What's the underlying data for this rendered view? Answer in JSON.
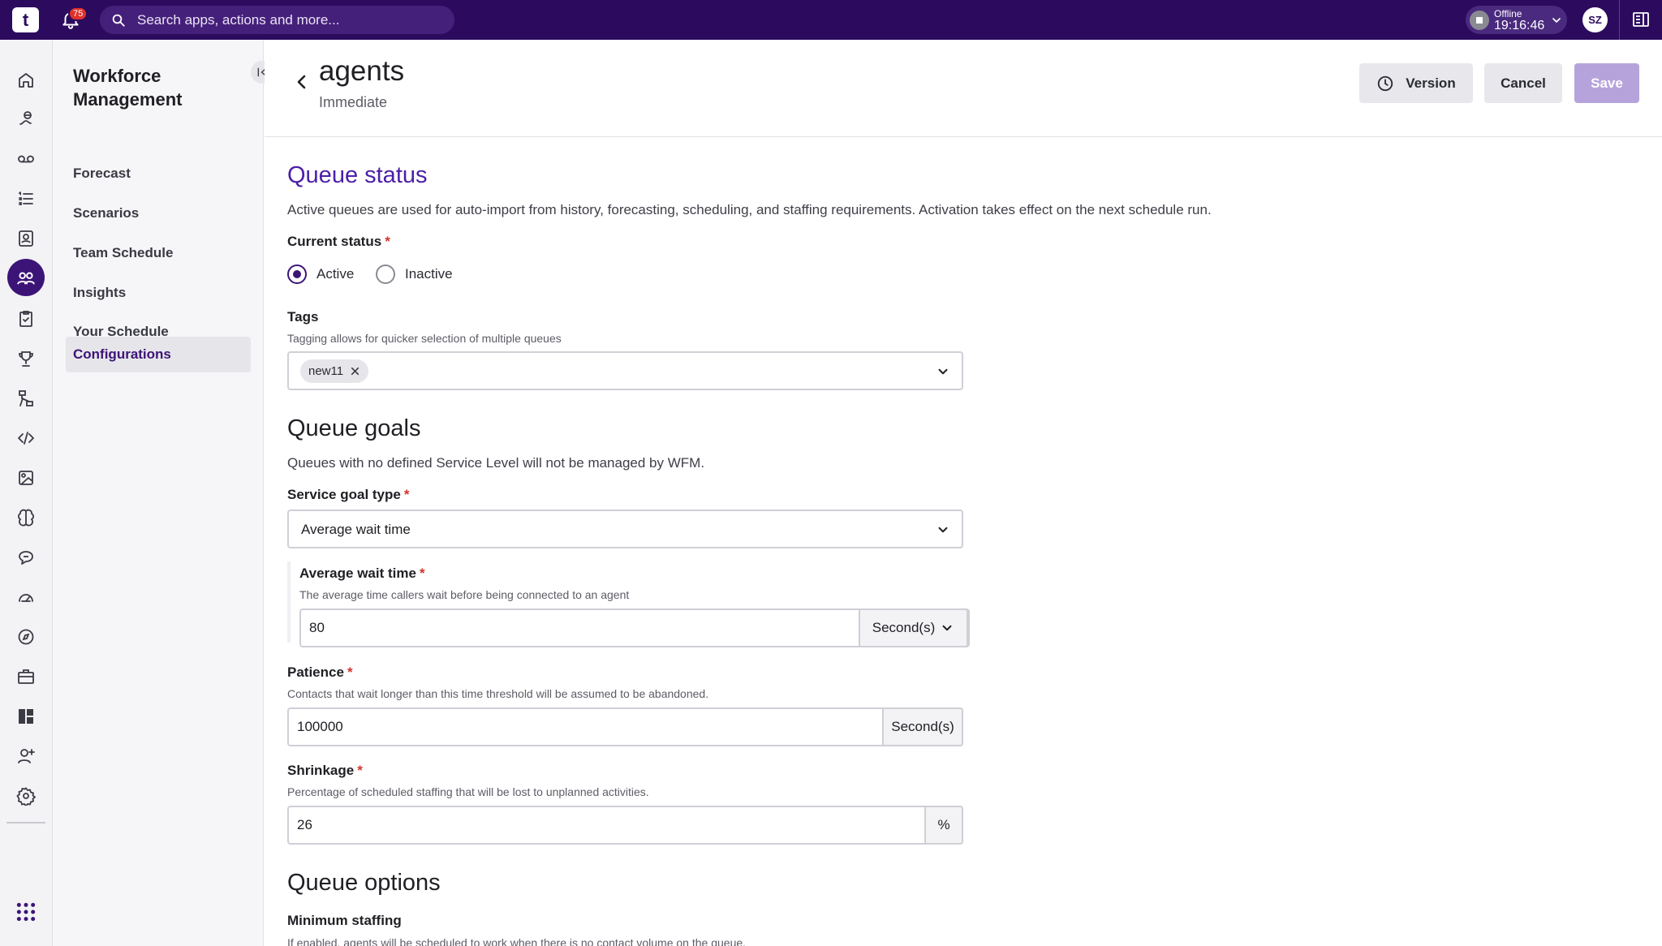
{
  "topbar": {
    "logo_text": "t",
    "notification_count": "75",
    "search_placeholder": "Search apps, actions and more...",
    "status_label": "Offline",
    "status_time": "19:16:46",
    "user_initials": "SZ"
  },
  "rail": {
    "icons": [
      "home-icon",
      "customer-journey-icon",
      "voicemail-icon",
      "list-icon",
      "contacts-icon",
      "workforce-icon",
      "tasks-icon",
      "trophy-icon",
      "flow-icon",
      "code-icon",
      "crop-icon",
      "brain-icon",
      "chat-icon",
      "dashboard-gauge-icon",
      "compass-icon",
      "briefcase-icon",
      "layout-icon",
      "user-add-icon",
      "settings-icon",
      "app-grid-icon"
    ],
    "active_index": 5
  },
  "subnav": {
    "title": "Workforce Management",
    "items": [
      {
        "label": "Forecast"
      },
      {
        "label": "Scenarios"
      },
      {
        "label": "Team Schedule"
      },
      {
        "label": "Insights"
      },
      {
        "label": "Your Schedule"
      },
      {
        "label": "Configurations"
      }
    ],
    "active": "Configurations"
  },
  "header": {
    "title": "agents",
    "subtitle": "Immediate",
    "version_label": "Version",
    "cancel_label": "Cancel",
    "save_label": "Save"
  },
  "queue_status": {
    "heading": "Queue status",
    "description": "Active queues are used for auto-import from history, forecasting, scheduling, and staffing requirements. Activation takes effect on the next schedule run.",
    "current_status_label": "Current status",
    "required_mark": "*",
    "options": [
      "Active",
      "Inactive"
    ],
    "selected": "Active",
    "tags_label": "Tags",
    "tags_hint": "Tagging allows for quicker selection of multiple queues",
    "tags": [
      "new11"
    ]
  },
  "queue_goals": {
    "heading": "Queue goals",
    "description": "Queues with no defined Service Level will not be managed by WFM.",
    "service_goal_type_label": "Service goal type",
    "service_goal_type_value": "Average wait time",
    "avg_wait_label": "Average wait time",
    "avg_wait_hint": "The average time callers wait before being connected to an agent",
    "avg_wait_value": "80",
    "avg_wait_unit": "Second(s)",
    "patience_label": "Patience",
    "patience_hint": "Contacts that wait longer than this time threshold will be assumed to be abandoned.",
    "patience_value": "100000",
    "patience_unit": "Second(s)",
    "shrinkage_label": "Shrinkage",
    "shrinkage_hint": "Percentage of scheduled staffing that will be lost to unplanned activities.",
    "shrinkage_value": "26",
    "shrinkage_unit": "%"
  },
  "queue_options": {
    "heading": "Queue options",
    "min_staffing_label": "Minimum staffing",
    "min_staffing_hint": "If enabled, agents will be scheduled to work when there is no contact volume on the queue."
  },
  "colors": {
    "topbar": "#2c0b5e",
    "accent": "#3c1478",
    "section_heading": "#4b1fa8",
    "required": "#d0342c"
  }
}
